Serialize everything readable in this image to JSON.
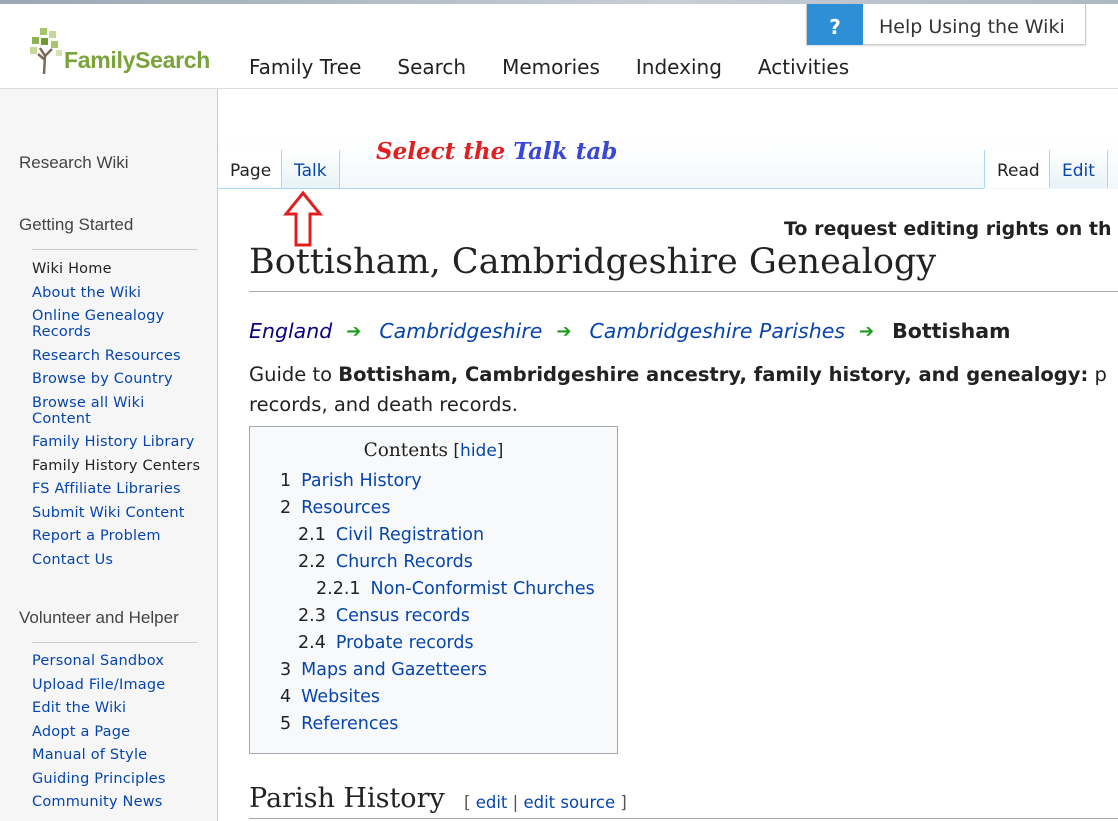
{
  "header": {
    "logo_text": "FamilySearch",
    "nav": [
      "Family Tree",
      "Search",
      "Memories",
      "Indexing",
      "Activities"
    ],
    "help": {
      "icon": "?",
      "label": "Help Using the Wiki"
    }
  },
  "sidebar": {
    "title": "Research Wiki",
    "sections": [
      {
        "heading": "Getting Started",
        "items": [
          {
            "label": "Wiki Home",
            "visited": true
          },
          {
            "label": "About the Wiki"
          },
          {
            "label": "Online Genealogy Records"
          },
          {
            "label": "Research Resources"
          },
          {
            "label": "Browse by Country"
          },
          {
            "label": "Browse all Wiki Content"
          },
          {
            "label": "Family History Library"
          },
          {
            "label": "Family History Centers",
            "visited": true
          },
          {
            "label": "FS Affiliate Libraries"
          },
          {
            "label": "Submit Wiki Content"
          },
          {
            "label": "Report a Problem"
          },
          {
            "label": "Contact Us"
          }
        ]
      },
      {
        "heading": "Volunteer and Helper",
        "items": [
          {
            "label": "Personal Sandbox"
          },
          {
            "label": "Upload File/Image"
          },
          {
            "label": "Edit the Wiki"
          },
          {
            "label": "Adopt a Page"
          },
          {
            "label": "Manual of Style"
          },
          {
            "label": "Guiding Principles"
          },
          {
            "label": "Community News"
          }
        ]
      }
    ]
  },
  "tabs": {
    "page": "Page",
    "talk": "Talk",
    "read": "Read",
    "edit": "Edit"
  },
  "annotation": {
    "before": "Select the ",
    "highlight": "Talk tab"
  },
  "notice": "To request editing rights on th",
  "article": {
    "title": "Bottisham, Cambridgeshire Genealogy",
    "breadcrumb": [
      "England",
      "Cambridgeshire",
      "Cambridgeshire Parishes"
    ],
    "breadcrumb_current": "Bottisham",
    "guide_prefix": "Guide to ",
    "guide_bold": "Bottisham, Cambridgeshire ancestry, family history, and genealogy:",
    "guide_tail": " p",
    "guide_line2": "records, and death records.",
    "section_heading": "Parish History",
    "section_edit": "edit",
    "section_edit_source": "edit source"
  },
  "toc": {
    "title": "Contents",
    "toggle": "hide",
    "items": [
      {
        "num": "1",
        "label": "Parish History",
        "level": 1
      },
      {
        "num": "2",
        "label": "Resources",
        "level": 1
      },
      {
        "num": "2.1",
        "label": "Civil Registration",
        "level": 2
      },
      {
        "num": "2.2",
        "label": "Church Records",
        "level": 2
      },
      {
        "num": "2.2.1",
        "label": "Non-Conformist Churches",
        "level": 3
      },
      {
        "num": "2.3",
        "label": "Census records",
        "level": 2
      },
      {
        "num": "2.4",
        "label": "Probate records",
        "level": 2
      },
      {
        "num": "3",
        "label": "Maps and Gazetteers",
        "level": 1
      },
      {
        "num": "4",
        "label": "Websites",
        "level": 1
      },
      {
        "num": "5",
        "label": "References",
        "level": 1
      }
    ]
  },
  "colors": {
    "link": "#0645ad",
    "visited": "#0b0080",
    "annotation": "#e02020",
    "annotation_highlight": "#3a46d6",
    "breadcrumb_arrow": "#1a9b1a",
    "help_blue": "#2e8fd6",
    "logo_green": "#7aa33a"
  }
}
